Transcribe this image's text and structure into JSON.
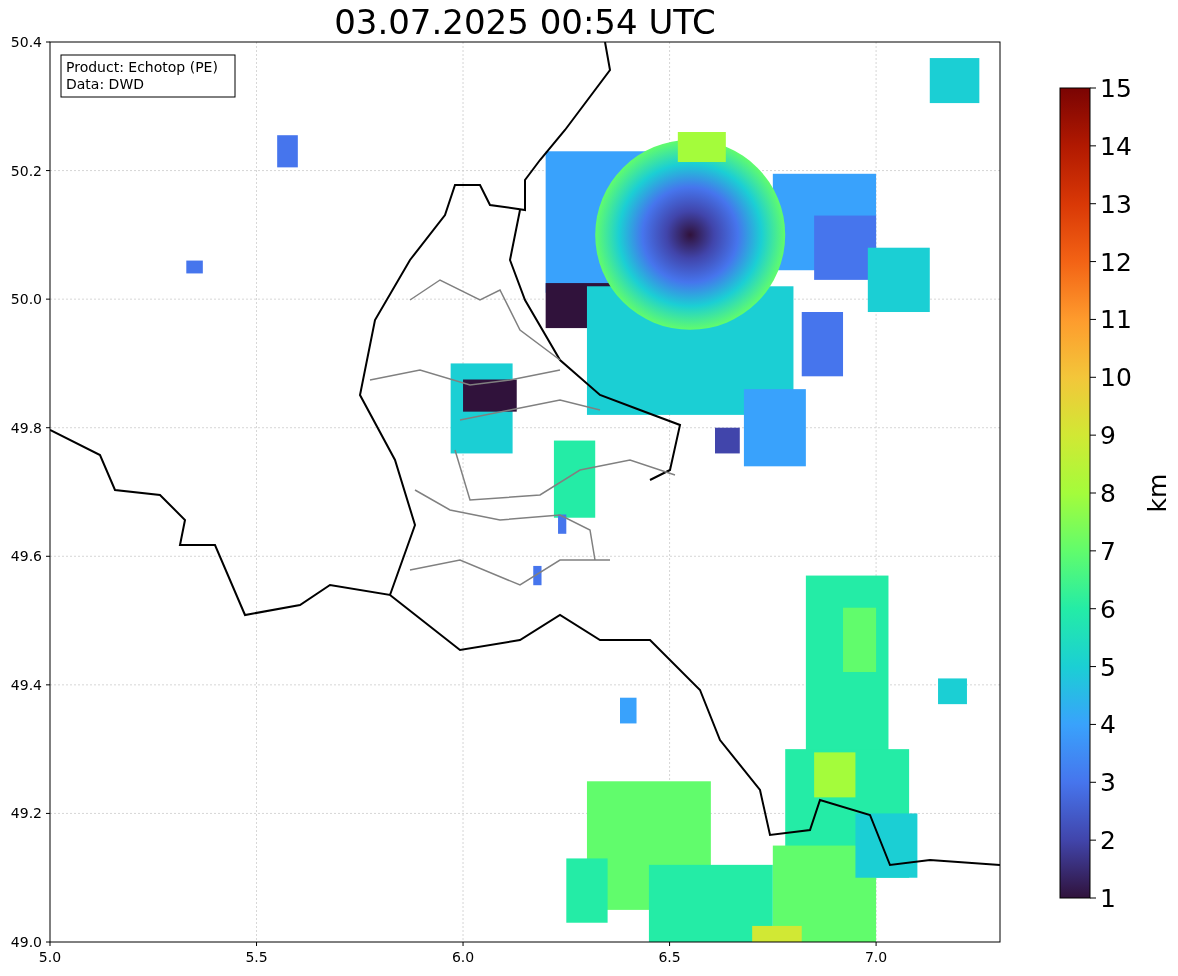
{
  "title": "03.07.2025 00:54 UTC",
  "info_box": [
    "Product: Echotop (PE)",
    "Data: DWD"
  ],
  "map": {
    "x_ticks": [
      "5.0",
      "5.5",
      "6.0",
      "6.5",
      "7.0"
    ],
    "y_ticks": [
      "50.4",
      "50.2",
      "50.0",
      "49.8",
      "49.6",
      "49.4",
      "49.2",
      "49.0"
    ]
  },
  "colorbar": {
    "label": "km",
    "ticks": [
      "15",
      "14",
      "13",
      "12",
      "11",
      "10",
      "9",
      "8",
      "7",
      "6",
      "5",
      "4",
      "3",
      "2",
      "1"
    ]
  }
}
